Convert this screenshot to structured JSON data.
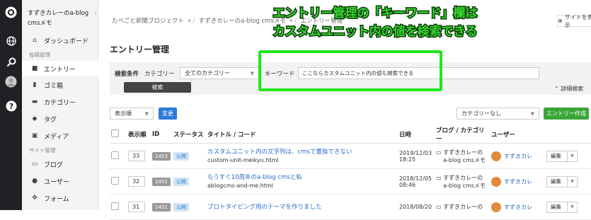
{
  "site": {
    "name": "すずきカレーのa-blog cmsメモ"
  },
  "nav": {
    "dashboard": "ダッシュボード",
    "section_posts": "投稿管理",
    "entry": "エントリー",
    "trash": "ゴミ箱",
    "category": "カテゴリー",
    "tag": "タグ",
    "media": "メディア",
    "section_site": "サイト管理",
    "blog": "ブログ",
    "user": "ユーザー",
    "form": "フォーム"
  },
  "breadcrumb": [
    "たべごと新聞プロジェクト",
    "すずきカレーのa-blog cmsメモ",
    "エントリー管理"
  ],
  "view_site": "サイトを表示",
  "page_title": "エントリー管理",
  "filter": {
    "heading": "検索条件",
    "category_label": "カテゴリー",
    "category_value": "全てのカテゴリー",
    "keyword_label": "キーワード",
    "keyword_value": "ここならカスタムユニット内の値も検索できる",
    "search_button": "検索",
    "advanced": "詳細検索"
  },
  "annotation": {
    "line1": "エントリー管理の「キーワード」欄は",
    "line2": "カスタムユニット内の値を検索できる",
    "color": "#34d22e"
  },
  "toolbar": {
    "order_value": "表示順",
    "change_button": "変更",
    "cat_select": "カテゴリーなし",
    "create_button": "エントリー作成"
  },
  "table": {
    "headers": [
      "表示順",
      "ID",
      "ステータス",
      "タイトル / コード",
      "日時",
      "ブログ / カテゴリー",
      "ユーザー"
    ],
    "rows": [
      {
        "order": "33",
        "id": "1453",
        "status": "公開",
        "title": "カスタムユニット内の文字列は、cmsで置換できない",
        "code": "custom-unit-meikyu.html",
        "date": "2019/12/03",
        "time": "18:25",
        "blog": "すずきカレーの",
        "blog2": "a-blog cmsメモ",
        "user": "すずきカレ",
        "edit": "編集"
      },
      {
        "order": "32",
        "id": "1452",
        "status": "公開",
        "title": "もうすぐ10周年のa-blog cmsと私",
        "code": "ablogcms-and-me.html",
        "date": "2018/12/05",
        "time": "08:46",
        "blog": "すずきカレーの",
        "blog2": "a-blog cmsメモ",
        "user": "すずきカレ",
        "edit": "編集"
      },
      {
        "order": "31",
        "id": "1451",
        "status": "公開",
        "title": "プロトタイピング用のテーマを作りました",
        "code": "",
        "date": "2018/08/20",
        "time": "",
        "blog": "すずきカレーの",
        "blog2": "",
        "user": "すずきカレ",
        "edit": "編集"
      }
    ]
  },
  "colors": {
    "accent": "#2d6ec7",
    "create": "#3aa63a",
    "change": "#2d7ad6"
  }
}
